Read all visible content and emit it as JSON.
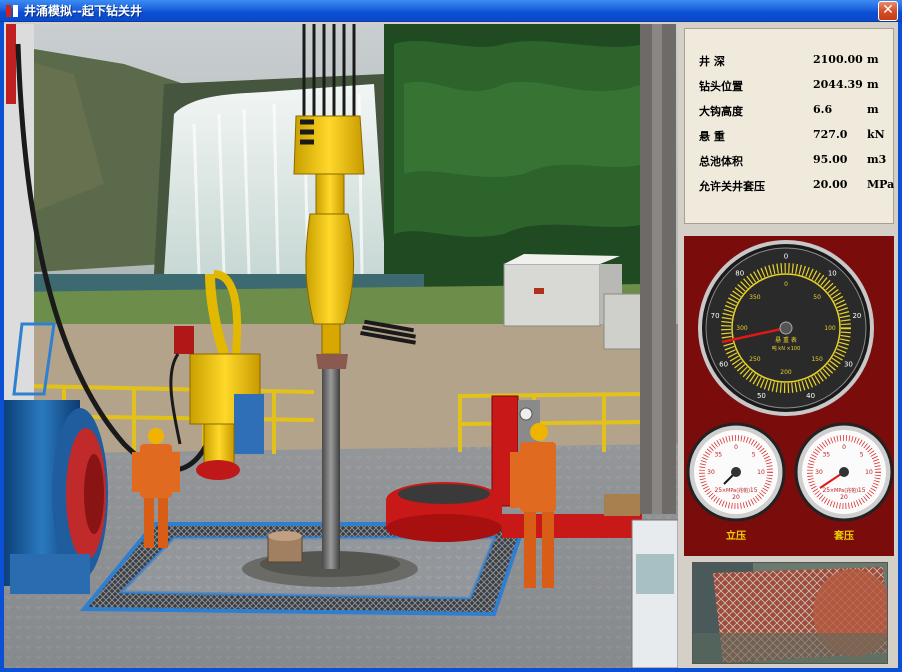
{
  "window": {
    "title": "井涌模拟--起下钻关井",
    "close_glyph": "✕"
  },
  "readouts": [
    {
      "label": "井  深",
      "value": "2100.00",
      "unit": "m"
    },
    {
      "label": "钻头位置",
      "value": "2044.39",
      "unit": "m"
    },
    {
      "label": "大钩高度",
      "value": "6.6",
      "unit": "m"
    },
    {
      "label": "悬  重",
      "value": "727.0",
      "unit": "kN"
    },
    {
      "label": "总池体积",
      "value": "95.00",
      "unit": "m3"
    },
    {
      "label": "允许关井套压",
      "value": "20.00",
      "unit": "MPa"
    }
  ],
  "main_gauge": {
    "outer_ticks": [
      "0",
      "10",
      "20",
      "30",
      "40",
      "50",
      "60",
      "70",
      "80"
    ],
    "inner_ticks": [
      "0",
      "50",
      "100",
      "150",
      "200",
      "250",
      "300",
      "350"
    ],
    "caption_line1": "悬 重 表",
    "caption_line2": "吨 kN ×100"
  },
  "small_gauges": {
    "standpipe": {
      "label": "立压",
      "ticks": [
        "0",
        "5",
        "10",
        "15",
        "20",
        "25",
        "30",
        "35"
      ],
      "unit": "×MPa(兆帕)"
    },
    "casing": {
      "label": "套压",
      "ticks": [
        "0",
        "5",
        "10",
        "15",
        "20",
        "25",
        "30",
        "35"
      ],
      "unit": "×MPa(兆帕)"
    }
  },
  "colors": {
    "titlebar": "#0a4fd4",
    "gauge_panel_bg": "#7a0c0c",
    "gauge_scale_yellow": "#e8d22a",
    "needle_red": "#e01818",
    "readout_bg": "#efeadc"
  }
}
